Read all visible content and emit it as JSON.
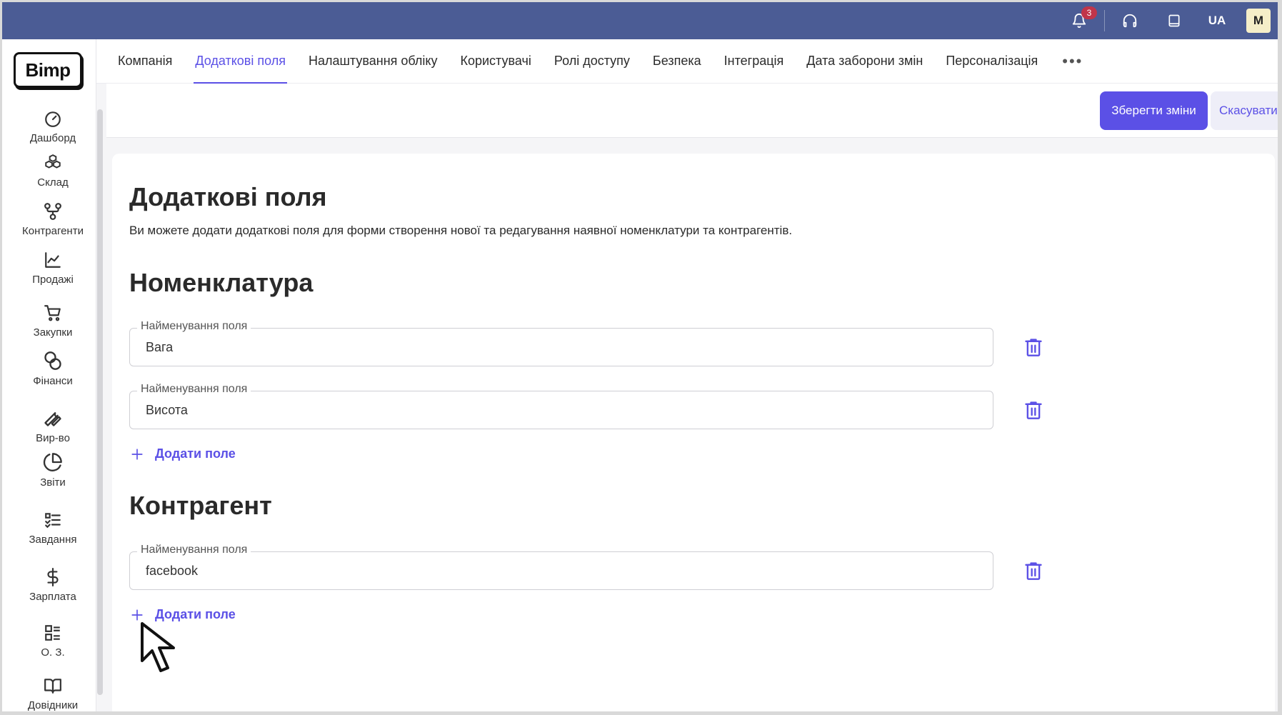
{
  "topbar": {
    "notifications_count": "3",
    "language": "UA",
    "avatar_initial": "M"
  },
  "logo": "Bimp",
  "sidebar": {
    "items": [
      {
        "label": "Дашборд",
        "icon": "gauge-icon"
      },
      {
        "label": "Склад",
        "icon": "boxes-icon"
      },
      {
        "label": "Контрагенти",
        "icon": "nodes-icon"
      },
      {
        "label": "Продажі",
        "icon": "chart-line-icon"
      },
      {
        "label": "Закупки",
        "icon": "cart-icon"
      },
      {
        "label": "Фінанси",
        "icon": "coins-icon"
      },
      {
        "label": "Вир-во",
        "icon": "wrench-icon"
      },
      {
        "label": "Звіти",
        "icon": "pie-chart-icon"
      },
      {
        "label": "Завдання",
        "icon": "checklist-icon"
      },
      {
        "label": "Зарплата",
        "icon": "dollar-icon"
      },
      {
        "label": "О. З.",
        "icon": "assets-list-icon"
      },
      {
        "label": "Довідники",
        "icon": "book-icon"
      }
    ]
  },
  "tabs": [
    {
      "label": "Компанія"
    },
    {
      "label": "Додаткові поля",
      "active": true
    },
    {
      "label": "Налаштування обліку"
    },
    {
      "label": "Користувачі"
    },
    {
      "label": "Ролі доступу"
    },
    {
      "label": "Безпека"
    },
    {
      "label": "Інтеграція"
    },
    {
      "label": "Дата заборони змін"
    },
    {
      "label": "Персоналізація"
    }
  ],
  "actions": {
    "save_label": "Зберегти зміни",
    "cancel_label": "Скасувати"
  },
  "page": {
    "title": "Додаткові поля",
    "description": "Ви можете додати додаткові поля для форми створення нової та редагування наявної номенклатури та контрагентів.",
    "nomenclature": {
      "title": "Номенклатура",
      "fields": [
        {
          "label": "Найменування поля",
          "value": "Вага"
        },
        {
          "label": "Найменування поля",
          "value": "Висота"
        }
      ],
      "add_label": "Додати поле"
    },
    "counterparty": {
      "title": "Контрагент",
      "fields": [
        {
          "label": "Найменування поля",
          "value": "facebook"
        }
      ],
      "add_label": "Додати поле"
    }
  },
  "colors": {
    "topbar": "#4b5c95",
    "accent": "#5b50e6",
    "badge": "#c0354a"
  }
}
